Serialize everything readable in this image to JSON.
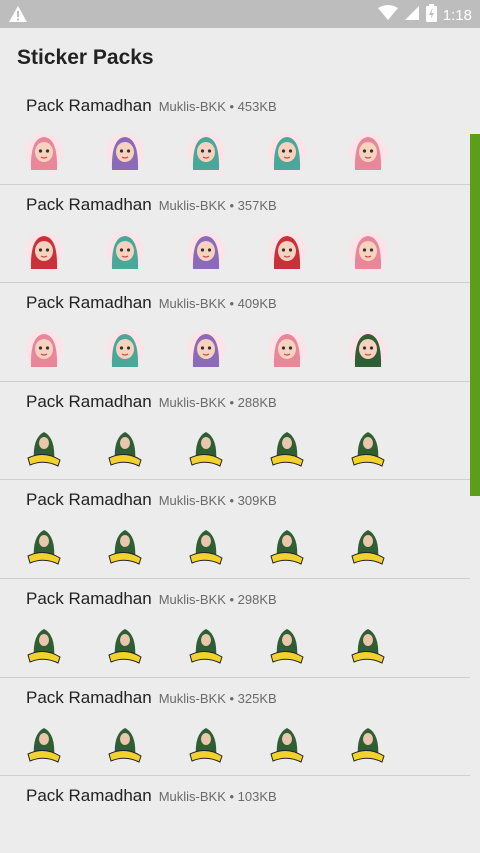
{
  "status_bar": {
    "time": "1:18"
  },
  "header": {
    "title": "Sticker Packs"
  },
  "packs": [
    {
      "name": "Pack Ramadhan",
      "author": "Muklis-BKK",
      "size": "453KB",
      "style": "cartoon"
    },
    {
      "name": "Pack Ramadhan",
      "author": "Muklis-BKK",
      "size": "357KB",
      "style": "cartoon"
    },
    {
      "name": "Pack Ramadhan",
      "author": "Muklis-BKK",
      "size": "409KB",
      "style": "cartoon"
    },
    {
      "name": "Pack Ramadhan",
      "author": "Muklis-BKK",
      "size": "288KB",
      "style": "photo"
    },
    {
      "name": "Pack Ramadhan",
      "author": "Muklis-BKK",
      "size": "309KB",
      "style": "photo"
    },
    {
      "name": "Pack Ramadhan",
      "author": "Muklis-BKK",
      "size": "298KB",
      "style": "photo"
    },
    {
      "name": "Pack Ramadhan",
      "author": "Muklis-BKK",
      "size": "325KB",
      "style": "photo"
    },
    {
      "name": "Pack Ramadhan",
      "author": "Muklis-BKK",
      "size": "103KB",
      "style": "photo"
    }
  ],
  "colors": {
    "accent_scrollbar": "#5a9e1a",
    "hijab_pink": "#e8869a",
    "hijab_purple": "#8b6bb8",
    "hijab_teal": "#4aa89a",
    "hijab_red": "#c9303a",
    "hijab_green": "#2f5e35",
    "text_yellow": "#f2d22e"
  },
  "icons": [
    "warning-icon",
    "wifi-icon",
    "signal-icon",
    "battery-icon"
  ]
}
